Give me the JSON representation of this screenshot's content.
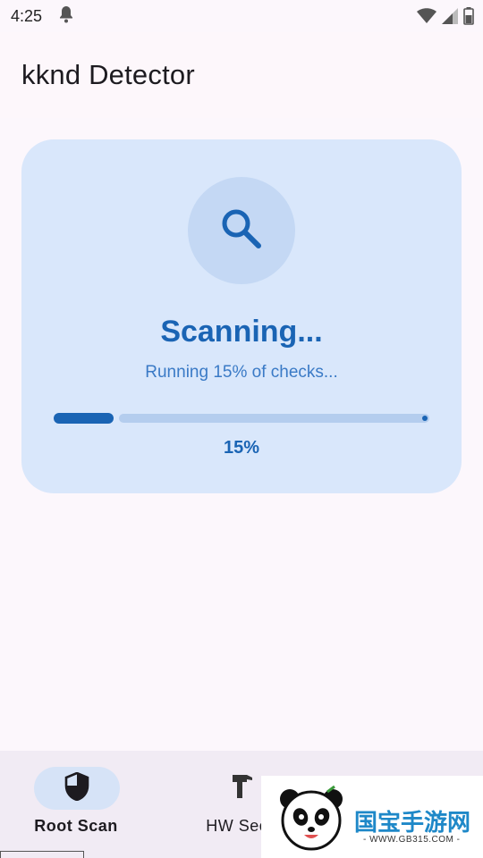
{
  "status_bar": {
    "time": "4:25"
  },
  "app": {
    "title": "kknd Detector"
  },
  "scan": {
    "title": "Scanning...",
    "subtitle": "Running 15% of checks...",
    "progress": 0.15,
    "progress_label": "15%",
    "icon": "search-icon"
  },
  "bottom_nav": {
    "items": [
      {
        "label": "Root Scan",
        "icon": "shield-icon",
        "active": true
      },
      {
        "label": "HW Secu",
        "icon": "hammer-icon",
        "active": false
      }
    ]
  },
  "watermark": {
    "text": "国宝手游网",
    "sub": "- WWW.GB315.COM -"
  },
  "colors": {
    "accent": "#1a64b4",
    "card": "#d9e7fb",
    "circle": "#c4d8f4",
    "track": "#b4cdee",
    "nav_bg": "#f1ebf4"
  }
}
